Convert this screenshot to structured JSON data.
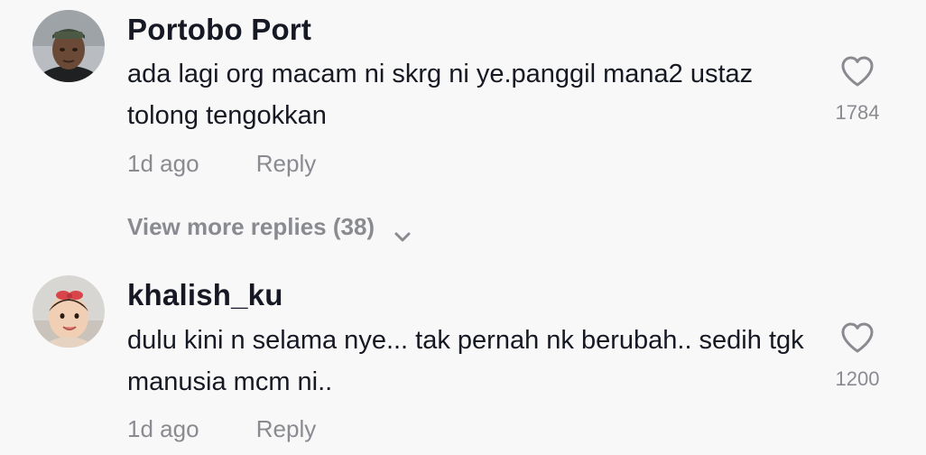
{
  "comments": [
    {
      "username": "Portobo Port",
      "text": "ada lagi org macam ni skrg ni ye.panggil mana2 ustaz tolong tengokkan",
      "time": "1d ago",
      "reply_label": "Reply",
      "likes": "1784"
    },
    {
      "username": "khalish_ku",
      "text": "dulu kini n selama nye... tak pernah nk berubah.. sedih tgk manusia mcm ni..",
      "time": "1d ago",
      "reply_label": "Reply",
      "likes": "1200"
    }
  ],
  "view_more": {
    "label": "View more replies (38)",
    "icon": "chevron-down-icon"
  },
  "icons": {
    "like": "heart-outline-icon"
  },
  "colors": {
    "background": "#f8f8f8",
    "primary_text": "#161823",
    "secondary_text": "#8a8b91"
  }
}
